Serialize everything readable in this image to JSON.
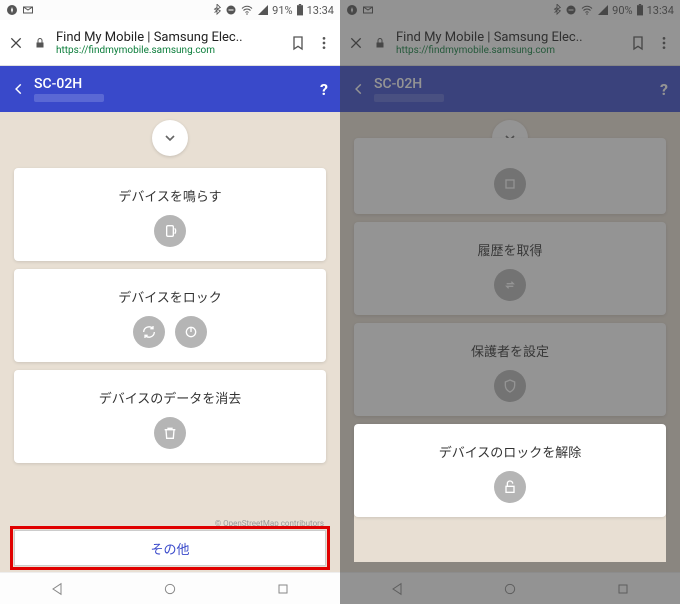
{
  "left": {
    "status": {
      "battery": "91%",
      "time": "13:34"
    },
    "browser": {
      "title": "Find My Mobile | Samsung Elec..",
      "url": "https://findmymobile.samsung.com"
    },
    "header": {
      "device": "SC-02H"
    },
    "cards": [
      {
        "title": "デバイスを鳴らす"
      },
      {
        "title": "デバイスをロック"
      },
      {
        "title": "デバイスのデータを消去"
      }
    ],
    "other_button": "その他",
    "map_credit": "© OpenStreetMap contributors"
  },
  "right": {
    "status": {
      "battery": "90%",
      "time": "13:34"
    },
    "browser": {
      "title": "Find My Mobile | Samsung Elec..",
      "url": "https://findmymobile.samsung.com"
    },
    "header": {
      "device": "SC-02H"
    },
    "cards": [
      {
        "title": "履歴を取得"
      },
      {
        "title": "保護者を設定"
      },
      {
        "title": "デバイスのロックを解除"
      }
    ]
  }
}
